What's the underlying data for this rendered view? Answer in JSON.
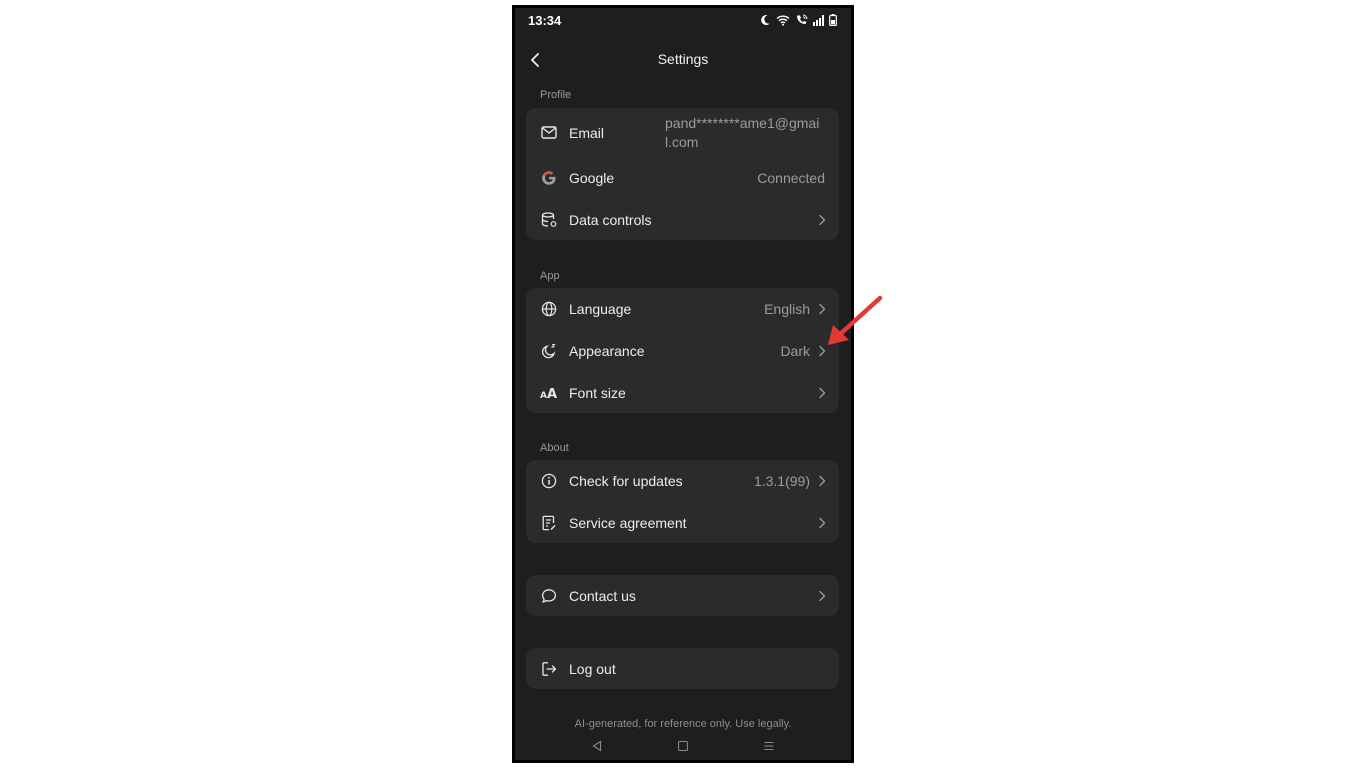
{
  "status_bar": {
    "time": "13:34",
    "icons": [
      "moon-icon",
      "wifi-icon",
      "wifi-call-icon",
      "signal-icon",
      "battery-icon"
    ]
  },
  "header": {
    "title": "Settings",
    "back_icon": "chevron-left-icon"
  },
  "sections": {
    "profile": {
      "label": "Profile",
      "email": {
        "label": "Email",
        "value": "pand********ame1@gmail.com",
        "icon": "mail-icon"
      },
      "google": {
        "label": "Google",
        "value": "Connected",
        "icon": "google-icon"
      },
      "data_controls": {
        "label": "Data controls",
        "icon": "database-icon"
      }
    },
    "app": {
      "label": "App",
      "language": {
        "label": "Language",
        "value": "English",
        "icon": "globe-icon"
      },
      "appearance": {
        "label": "Appearance",
        "value": "Dark",
        "icon": "moon-sparkle-icon"
      },
      "font_size": {
        "label": "Font size",
        "icon": "font-size-icon"
      }
    },
    "about": {
      "label": "About",
      "check_updates": {
        "label": "Check for updates",
        "value": "1.3.1(99)",
        "icon": "info-icon"
      },
      "service_agreement": {
        "label": "Service agreement",
        "icon": "document-icon"
      }
    },
    "contact": {
      "label": "Contact us",
      "icon": "chat-bubble-icon"
    },
    "logout": {
      "label": "Log out",
      "icon": "logout-icon"
    }
  },
  "footer": {
    "note": "AI-generated, for reference only. Use legally."
  },
  "nav_bar": {
    "icons": [
      "back-triangle-icon",
      "home-square-icon",
      "recents-menu-icon"
    ]
  },
  "colors": {
    "background": "#1e1e1e",
    "card": "#2b2b2b",
    "text": "#ececec",
    "muted": "#9c9c9c",
    "annotation_arrow": "#e53935"
  }
}
